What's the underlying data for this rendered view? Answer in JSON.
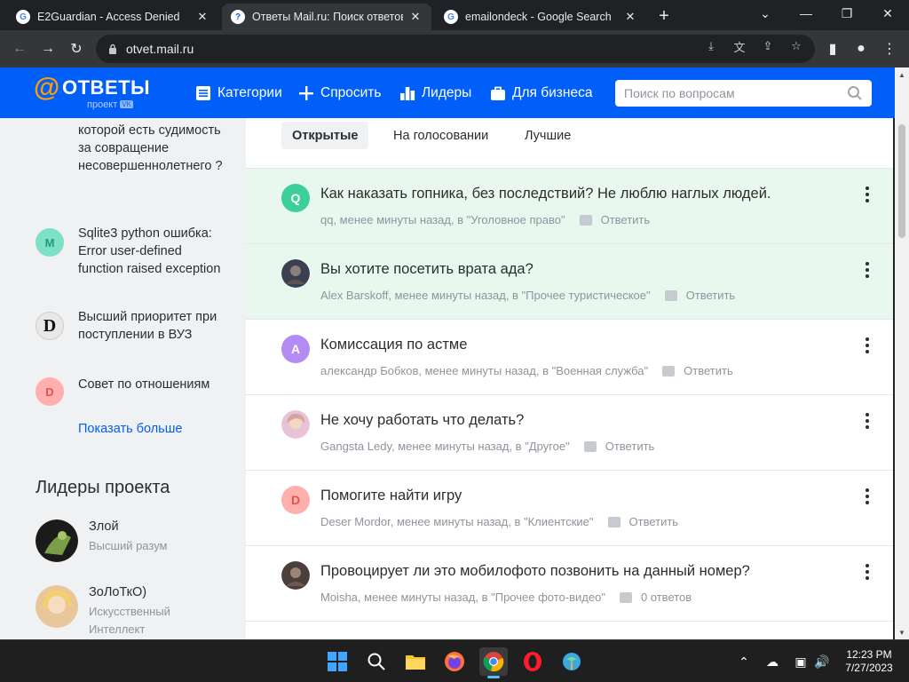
{
  "browser": {
    "tabs": [
      {
        "title": "E2Guardian - Access Denied",
        "favicon": "google-g-icon"
      },
      {
        "title": "Ответы Mail.ru: Поиск ответов на",
        "favicon": "mail-answers-icon"
      },
      {
        "title": "emailondeck - Google Search",
        "favicon": "google-g-icon"
      }
    ],
    "url": "otvet.mail.ru"
  },
  "header": {
    "logo_word": "ОТВЕТЫ",
    "logo_sub": "проект",
    "logo_vk": "VK",
    "nav": [
      {
        "label": "Категории",
        "icon": "list-icon"
      },
      {
        "label": "Спросить",
        "icon": "plus-icon"
      },
      {
        "label": "Лидеры",
        "icon": "bar-chart-icon"
      },
      {
        "label": "Для бизнеса",
        "icon": "briefcase-icon"
      }
    ],
    "search_placeholder": "Поиск по вопросам"
  },
  "sidebar": {
    "questions": [
      {
        "text": "которой есть судимость за совращение несовершеннолетнего ?",
        "letter": "",
        "color": ""
      },
      {
        "text": "Sqlite3 python ошибка: Error user-defined function raised exception",
        "letter": "М",
        "color": "#7ee0c6"
      },
      {
        "text": "Высший приоритет при поступлении в ВУЗ",
        "letter": "D",
        "color": "#e8e8e8"
      },
      {
        "text": "Совет по отношениям",
        "letter": "D",
        "color": "#ffb0ae"
      }
    ],
    "show_more": "Показать больше",
    "leaders_title": "Лидеры проекта",
    "leaders": [
      {
        "name": "Злой",
        "rank": "Высший разум"
      },
      {
        "name": "ЗоЛоТкО)",
        "rank": "Искусственный Интеллект"
      }
    ]
  },
  "filter_tabs": [
    "Открытые",
    "На голосовании",
    "Лучшие"
  ],
  "questions": [
    {
      "title": "Как наказать гопника, без последствий? Не люблю наглых людей.",
      "meta": "qq, менее минуты назад, в \"Уголовное право\"",
      "action": "Ответить",
      "letter": "Q",
      "color": "#3ccf9b",
      "highlight": true
    },
    {
      "title": "Вы хотите посетить врата ада?",
      "meta": "Alex Barskoff, менее минуты назад, в \"Прочее туристическое\"",
      "action": "Ответить",
      "letter": "",
      "color": "#3b3f52",
      "highlight": true
    },
    {
      "title": "Комиссация по астме",
      "meta": "александр Бобков, менее минуты назад, в \"Военная служба\"",
      "action": "Ответить",
      "letter": "А",
      "color": "#b48bf2",
      "highlight": false
    },
    {
      "title": "Не хочу работать что делать?",
      "meta": "Gangsta Ledy, менее минуты назад, в \"Другое\"",
      "action": "Ответить",
      "letter": "",
      "color": "#e8c3d8",
      "highlight": false
    },
    {
      "title": "Помогите найти игру",
      "meta": "Deser Mordor, менее минуты назад, в \"Клиентские\"",
      "action": "Ответить",
      "letter": "D",
      "color": "#ffb0ae",
      "highlight": false
    },
    {
      "title": "Провоцирует ли это мобилофото позвонить на данный номер?",
      "meta": "Moisha, менее минуты назад, в \"Прочее фото-видео\"",
      "action": "0 ответов",
      "letter": "",
      "color": "#4a3f3a",
      "highlight": false
    }
  ],
  "taskbar": {
    "time": "12:23 PM",
    "date": "7/27/2023"
  }
}
